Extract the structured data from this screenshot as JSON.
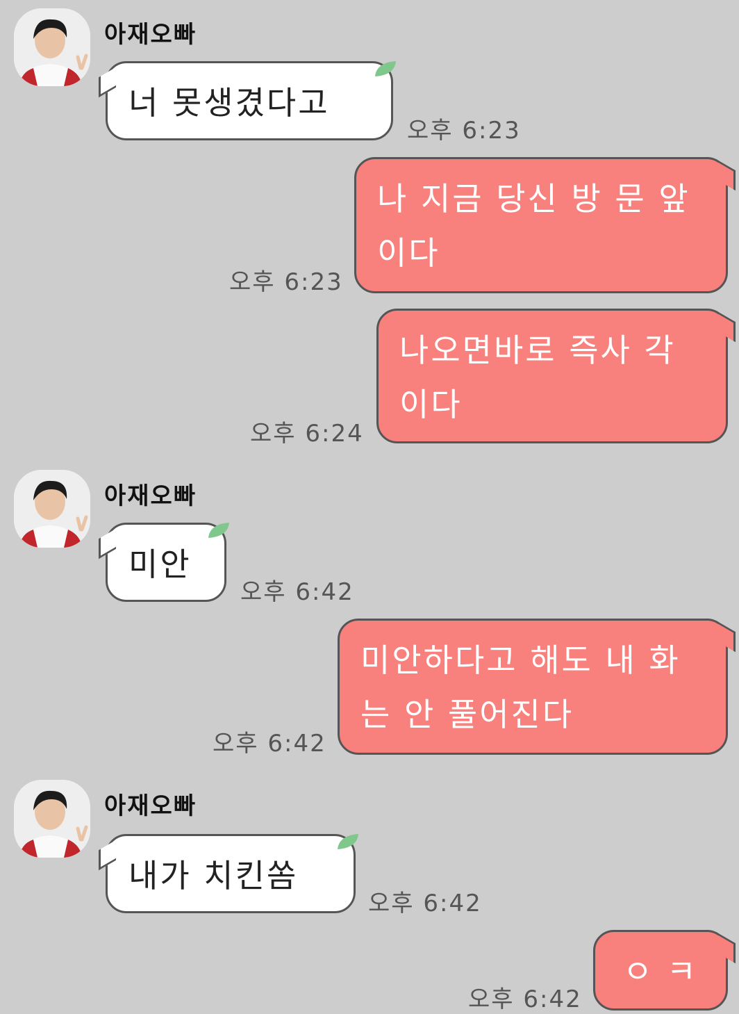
{
  "sender_name": "아재오빠",
  "messages": [
    {
      "side": "in",
      "text": "너 못생겼다고",
      "time": "오후 6:23"
    },
    {
      "side": "out",
      "text": "나 지금 당신 방 문 앞이다",
      "time": "오후 6:23"
    },
    {
      "side": "out",
      "text": "나오면바로 즉사 각이다",
      "time": "오후 6:24"
    },
    {
      "side": "in",
      "text": "미안",
      "time": "오후 6:42"
    },
    {
      "side": "out",
      "text": "미안하다고 해도 내 화는 안 풀어진다",
      "time": "오후 6:42"
    },
    {
      "side": "in",
      "text": "내가 치킨쏨",
      "time": "오후 6:42"
    },
    {
      "side": "out",
      "text": "ㅇ ㅋ",
      "time": "오후 6:42"
    }
  ],
  "colors": {
    "background": "#cdcdcd",
    "outgoing_bubble": "#f8817e",
    "incoming_bubble": "#ffffff",
    "leaf": "#7fc78a"
  },
  "icons": {
    "avatar": "profile-photo",
    "leaf": "leaf-icon"
  }
}
